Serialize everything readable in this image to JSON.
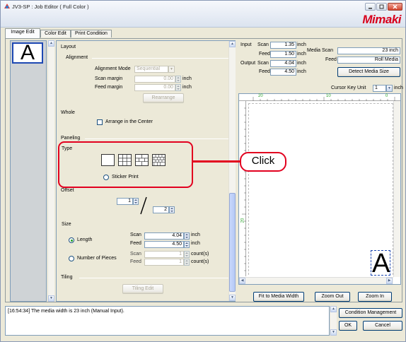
{
  "window": {
    "title": "JV3-SP : Job Editor ( Full Color )",
    "logo": "Mimaki",
    "icons": [
      "app-icon",
      "minimize-icon",
      "maximize-icon",
      "close-icon"
    ]
  },
  "tabs": [
    {
      "label": "Image Edit",
      "active": true
    },
    {
      "label": "Color Edit",
      "active": false
    },
    {
      "label": "Print Condition",
      "active": false
    }
  ],
  "preview": {
    "letter": "A"
  },
  "layout": {
    "heading": "Layout",
    "alignment": {
      "heading": "Alignment",
      "mode_label": "Alignment Mode",
      "mode_value": "Sequential",
      "scan_margin_label": "Scan margin",
      "scan_margin_value": "0.00",
      "feed_margin_label": "Feed margin",
      "feed_margin_value": "0.00",
      "unit": "inch",
      "rearrange_label": "Rearrange"
    },
    "whole": {
      "heading": "Whole",
      "arrange_center_label": "Arrange in the Center"
    },
    "paneling": {
      "heading": "Paneling",
      "type_label": "Type",
      "sticker_print_label": "Sticker Print",
      "offset_label": "Offset",
      "offset_top_value": "1",
      "offset_bottom_value": "2",
      "size_label": "Size",
      "length_label": "Length",
      "scan_label": "Scan",
      "feed_label": "Feed",
      "length_scan_value": "4.04",
      "length_feed_value": "4.50",
      "unit_inch": "inch",
      "pieces_label": "Number of Pieces",
      "pieces_scan_value": "1",
      "pieces_feed_value": "1",
      "unit_count": "count(s)"
    },
    "tiling": {
      "heading": "Tiling",
      "edit_label": "Tiling Edit"
    }
  },
  "info": {
    "input_label": "Input",
    "output_label": "Output",
    "scan_label": "Scan",
    "feed_label": "Feed",
    "input_scan": "1.35",
    "input_feed": "1.50",
    "output_scan": "4.04",
    "output_feed": "4.50",
    "unit": "inch",
    "media_scan_label": "Media Scan",
    "media_scan_value": "23 inch",
    "media_feed_label": "Feed",
    "media_feed_value": "Roll Media",
    "detect_label": "Detect Media Size",
    "cursor_key_label": "Cursor Key Unit",
    "cursor_key_value": "1",
    "cursor_key_unit": "inch"
  },
  "ruler": {
    "top_labels": [
      "20",
      "10",
      "0"
    ],
    "side_labels": [
      "20",
      "10"
    ]
  },
  "canvas": {
    "letter": "A"
  },
  "canvas_buttons": {
    "fit": "Fit to Media Width",
    "zoom_out": "Zoom Out",
    "zoom_in": "Zoom In"
  },
  "status_message": "[16:54:34] The media width is 23 inch (Manual Input).",
  "bottom_buttons": {
    "condition_management": "Condition Management",
    "ok": "OK",
    "cancel": "Cancel"
  },
  "annotation": {
    "label": "Click"
  },
  "colors": {
    "annotation": "#e2001f",
    "logo": "#d8001c"
  }
}
